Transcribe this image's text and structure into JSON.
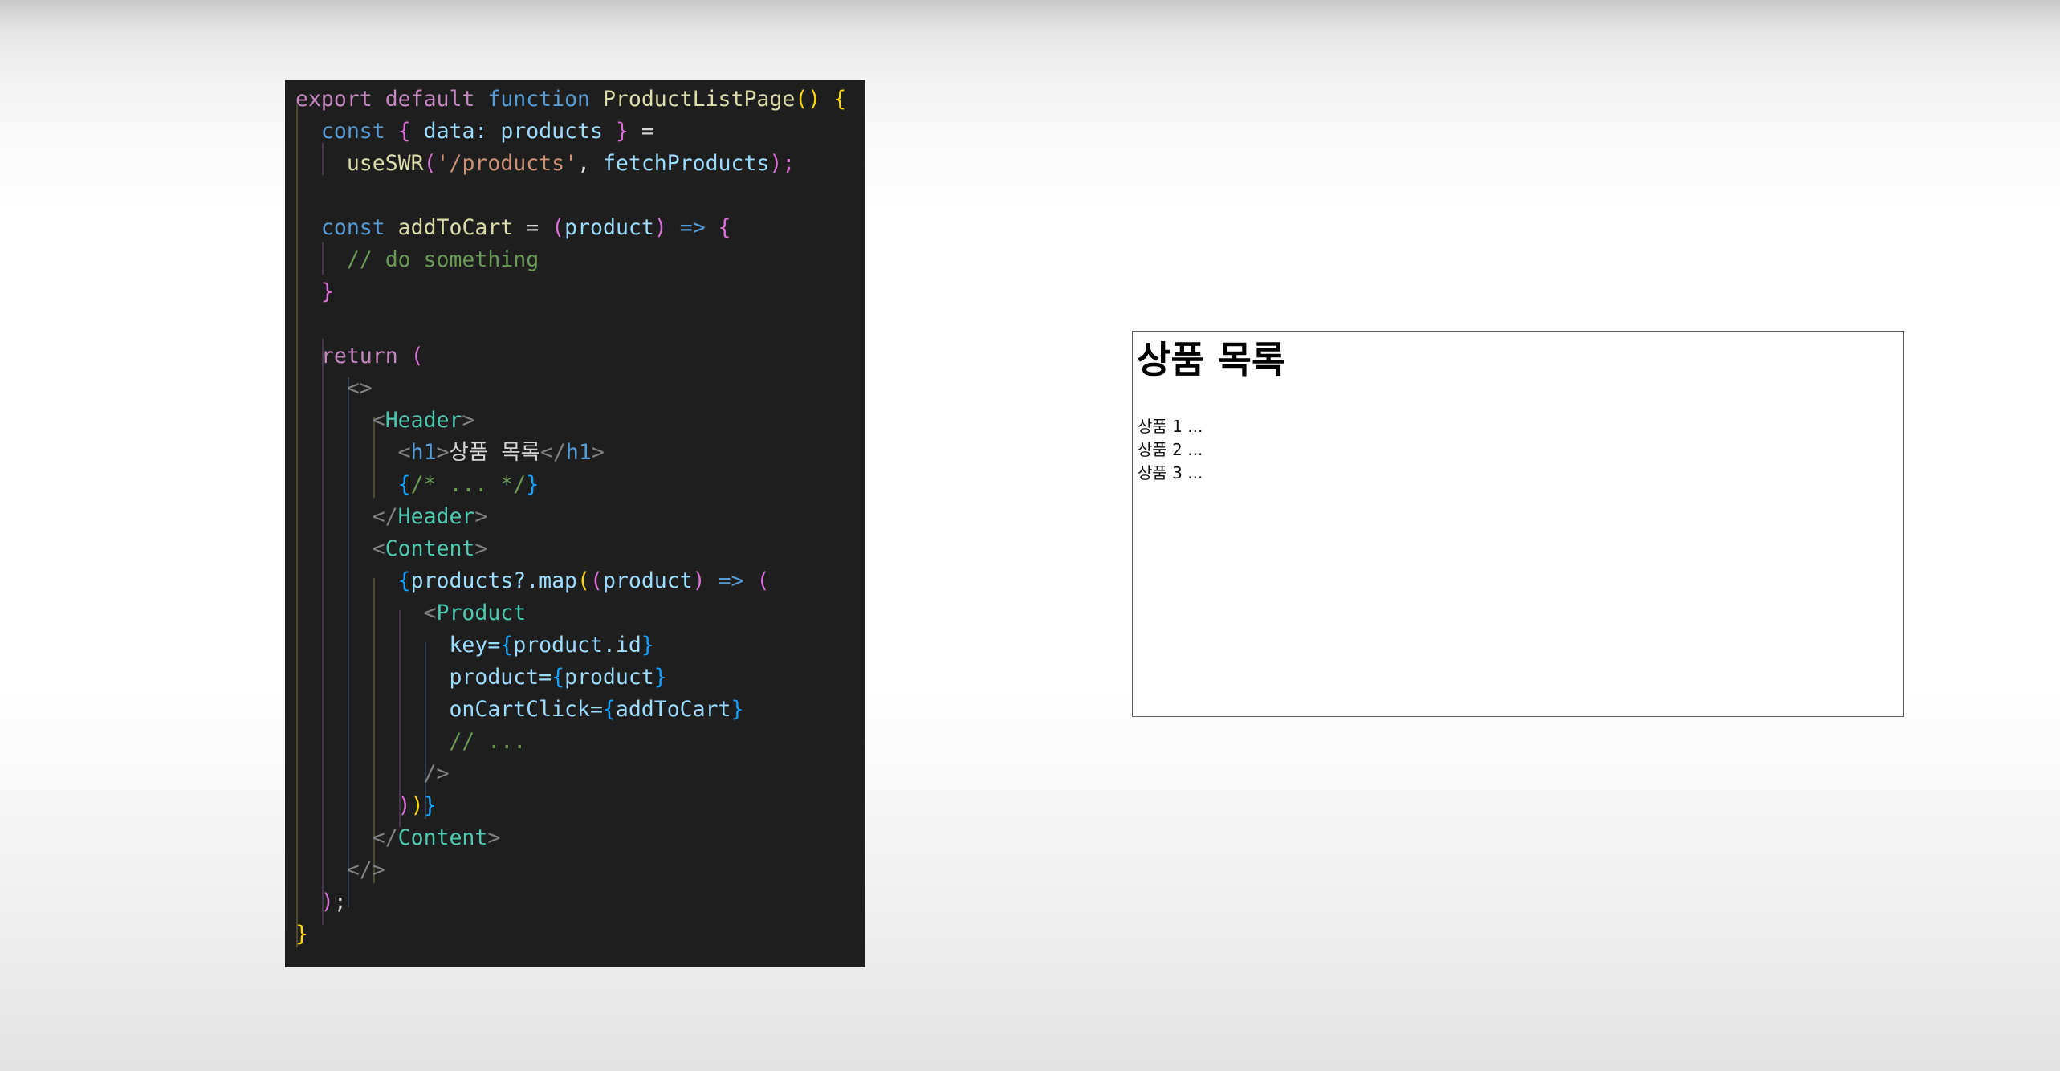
{
  "code": {
    "line01": {
      "a": "export",
      "b": "default",
      "c": "function",
      "d": "ProductListPage",
      "e": "()",
      "f": "{"
    },
    "line02": {
      "a": "const",
      "b": "{",
      "c": "data:",
      "d": "products",
      "e": "}",
      "f": "="
    },
    "line03": {
      "a": "useSWR",
      "b": "(",
      "c": "'/products'",
      "d": ",",
      "e": "fetchProducts",
      "f": ");"
    },
    "line05": {
      "a": "const",
      "b": "addToCart",
      "c": "=",
      "d": "(",
      "e": "product",
      "f": ")",
      "g": "=>",
      "h": "{"
    },
    "line06": {
      "a": "// do something"
    },
    "line07": {
      "a": "}"
    },
    "line09": {
      "a": "return",
      "b": "("
    },
    "line10": {
      "a": "<>"
    },
    "line11": {
      "a": "<",
      "b": "Header",
      "c": ">"
    },
    "line12": {
      "a": "<",
      "b": "h1",
      "c": ">",
      "d": "상품 목록",
      "e": "</",
      "f": "h1",
      "g": ">"
    },
    "line13": {
      "a": "{",
      "b": "/* ... */",
      "c": "}"
    },
    "line14": {
      "a": "</",
      "b": "Header",
      "c": ">"
    },
    "line15": {
      "a": "<",
      "b": "Content",
      "c": ">"
    },
    "line16": {
      "a": "{",
      "b": "products?.map",
      "c": "(",
      "d": "(",
      "e": "product",
      "f": ")",
      "g": "=>",
      "h": "("
    },
    "line17": {
      "a": "<",
      "b": "Product"
    },
    "line18": {
      "a": "key=",
      "b": "{",
      "c": "product.id",
      "d": "}"
    },
    "line19": {
      "a": "product=",
      "b": "{",
      "c": "product",
      "d": "}"
    },
    "line20": {
      "a": "onCartClick=",
      "b": "{",
      "c": "addToCart",
      "d": "}"
    },
    "line21": {
      "a": "// ..."
    },
    "line22": {
      "a": "/>"
    },
    "line23": {
      "a": ")",
      "b": ")",
      "c": "}"
    },
    "line24": {
      "a": "</",
      "b": "Content",
      "c": ">"
    },
    "line25": {
      "a": "</>"
    },
    "line26": {
      "a": ")",
      "b": ";"
    },
    "line27": {
      "a": "}"
    }
  },
  "preview": {
    "heading": "상품 목록",
    "items": [
      "상품 1 ...",
      "상품 2 ...",
      "상품 3 ..."
    ]
  }
}
